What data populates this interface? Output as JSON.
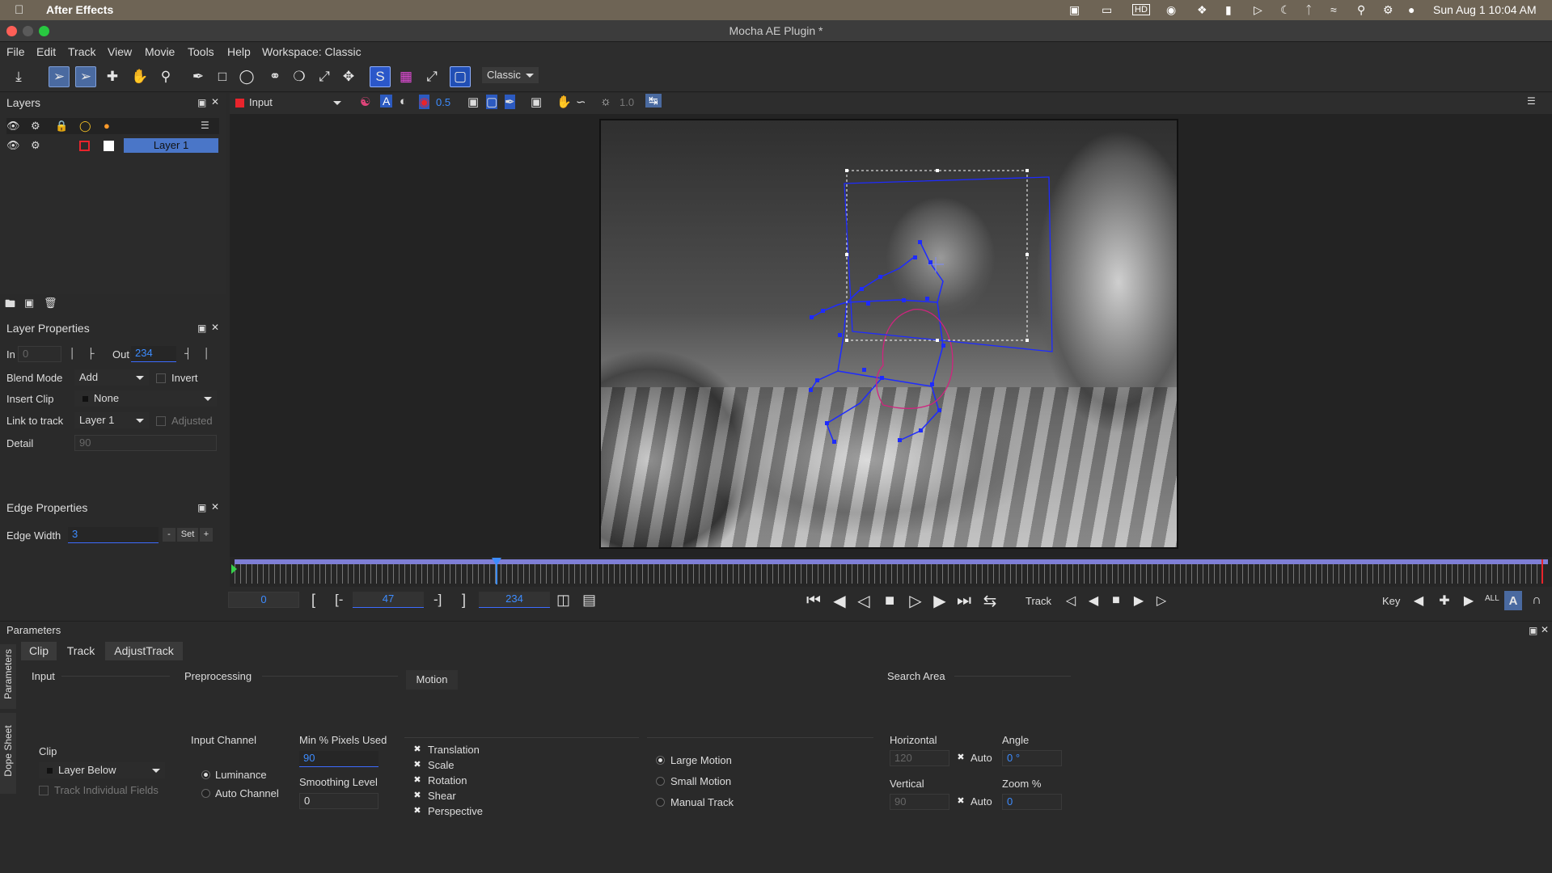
{
  "mac": {
    "app": "After Effects",
    "datetime": "Sun Aug 1  10:04 AM"
  },
  "window": {
    "title": "Mocha AE Plugin *"
  },
  "menu": [
    "File",
    "Edit",
    "Track",
    "View",
    "Movie",
    "Tools",
    "Help",
    "Workspace: Classic"
  ],
  "toolbar": {
    "workspace_select": "Classic"
  },
  "viewer": {
    "input_select": "Input",
    "opacity": "0.5",
    "exposure": "1.0"
  },
  "layers": {
    "title": "Layers",
    "items": [
      {
        "name": "Layer 1"
      }
    ]
  },
  "layer_props": {
    "title": "Layer Properties",
    "in_label": "In",
    "in_value": "0",
    "out_label": "Out",
    "out_value": "234",
    "blend_label": "Blend Mode",
    "blend_value": "Add",
    "invert_label": "Invert",
    "insert_label": "Insert Clip",
    "insert_value": "None",
    "link_label": "Link to track",
    "link_value": "Layer 1",
    "adjusted_label": "Adjusted",
    "detail_label": "Detail",
    "detail_value": "90"
  },
  "edge_props": {
    "title": "Edge Properties",
    "width_label": "Edge Width",
    "width_value": "3",
    "minus": "-",
    "set": "Set",
    "plus": "+"
  },
  "timeline": {
    "start": "0",
    "current": "47",
    "end": "234",
    "in_bracket": "[",
    "in_set": "[-",
    "out_set": "-]",
    "out_bracket": "]",
    "track_label": "Track",
    "key_label": "Key",
    "all_label": "ALL"
  },
  "params": {
    "title": "Parameters",
    "side_tabs": [
      "Parameters",
      "Dope Sheet"
    ],
    "tabs": [
      "Clip",
      "Track",
      "AdjustTrack"
    ],
    "input_section": "Input",
    "clip_label": "Clip",
    "clip_value": "Layer Below",
    "track_fields_label": "Track Individual Fields",
    "preprocessing_section": "Preprocessing",
    "input_channel_label": "Input Channel",
    "luminance": "Luminance",
    "auto_channel": "Auto Channel",
    "min_pixels_label": "Min % Pixels Used",
    "min_pixels_value": "90",
    "smoothing_label": "Smoothing Level",
    "smoothing_value": "0",
    "motion_section": "Motion",
    "motion_options": [
      "Translation",
      "Scale",
      "Rotation",
      "Shear",
      "Perspective"
    ],
    "large_motion": "Large Motion",
    "small_motion": "Small Motion",
    "manual_track": "Manual Track",
    "search_section": "Search Area",
    "horizontal_label": "Horizontal",
    "horizontal_value": "120",
    "auto1": "Auto",
    "angle_label": "Angle",
    "angle_value": "0 °",
    "vertical_label": "Vertical",
    "vertical_value": "90",
    "auto2": "Auto",
    "zoom_label": "Zoom %",
    "zoom_value": "0"
  },
  "colors": {
    "accent": "#3d8cff",
    "selection": "#4a76c8",
    "spline": "#1e2bff",
    "layer_curve": "#d0247f"
  }
}
